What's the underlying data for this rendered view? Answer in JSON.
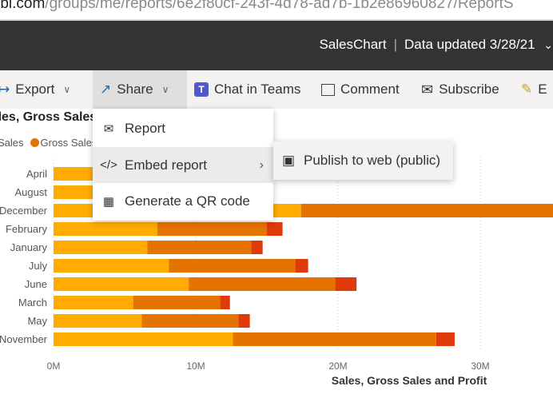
{
  "browser": {
    "url_host": "rbi.com",
    "url_path": "/groups/me/reports/6e2f80cf-243f-4d78-ad7b-1b2e86960827/ReportS"
  },
  "header": {
    "report_name": "SalesChart",
    "data_updated": "Data updated 3/28/21",
    "chevron": "⌄"
  },
  "toolbar": {
    "export": "Export",
    "share": "Share",
    "chat_in_teams": "Chat in Teams",
    "comment": "Comment",
    "subscribe": "Subscribe",
    "edit": "E"
  },
  "share_menu": {
    "items": [
      {
        "label": "Report",
        "icon": "mail-report-icon"
      },
      {
        "label": "Embed report",
        "icon": "code-icon"
      },
      {
        "label": "Generate a QR code",
        "icon": "qr-code-icon"
      }
    ],
    "submenu": {
      "label": "Publish to web (public)",
      "icon": "publish-web-icon"
    }
  },
  "colors": {
    "sales": "#ffab00",
    "gross_sales": "#e57300",
    "profit": "#e03a0a"
  },
  "chart_data": {
    "type": "bar",
    "orientation": "horizontal",
    "stacked": true,
    "title": "Sales, Gross Sales",
    "legend": [
      "Sales",
      "Gross Sales"
    ],
    "legend_placement": "top-left",
    "xlabel": "Sales, Gross Sales and Profit",
    "xlim": [
      0,
      35
    ],
    "x_ticks": [
      "0M",
      "10M",
      "20M",
      "30M"
    ],
    "grid": true,
    "categories": [
      "April",
      "August",
      "December",
      "February",
      "January",
      "July",
      "June",
      "March",
      "May",
      "November"
    ],
    "series": [
      {
        "name": "Sales",
        "values": [
          7,
          7,
          17.4,
          7.3,
          6.6,
          8.1,
          9.5,
          5.6,
          6.2,
          12.6
        ]
      },
      {
        "name": "Gross Sales",
        "values": [
          6,
          6,
          20,
          7.7,
          7.3,
          8.9,
          10.3,
          6.1,
          6.8,
          14.3
        ]
      },
      {
        "name": "Profit",
        "values": [
          1,
          1,
          1.5,
          1.1,
          0.8,
          0.9,
          1.5,
          0.7,
          0.8,
          1.3
        ]
      }
    ]
  }
}
